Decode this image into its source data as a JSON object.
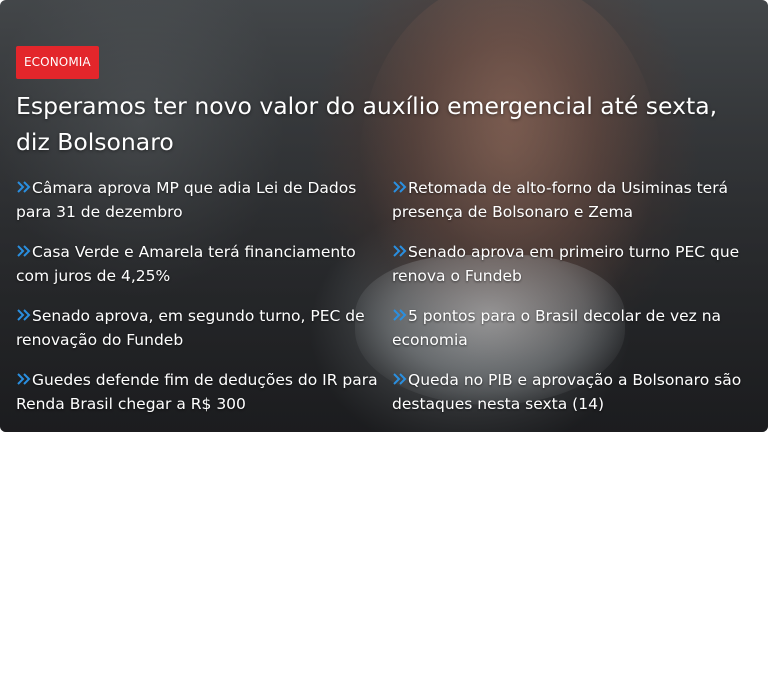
{
  "card": {
    "tag": "ECONOMIA",
    "headline": "Esperamos ter novo valor do auxílio emergencial até sexta, diz Bolsonaro",
    "links": [
      "Câmara aprova MP que adia Lei de Dados para 31 de dezembro",
      "Retomada de alto-forno da Usiminas terá presença de Bolsonaro e Zema",
      "Casa Verde e Amarela terá financiamento com juros de 4,25%",
      "Senado aprova em primeiro turno PEC que renova o Fundeb",
      "Senado aprova, em segundo turno, PEC de renovação do Fundeb",
      "5 pontos para o Brasil decolar de vez na economia",
      "Guedes defende fim de deduções do IR para Renda Brasil chegar a R$ 300",
      "Queda no PIB e aprovação a Bolsonaro são destaques nesta sexta (14)"
    ]
  },
  "colors": {
    "tag_background": "#e3262b",
    "chevron": "#2a8fe0",
    "text": "#ffffff"
  },
  "icons": {
    "link_marker": "double-chevron-right-icon"
  }
}
